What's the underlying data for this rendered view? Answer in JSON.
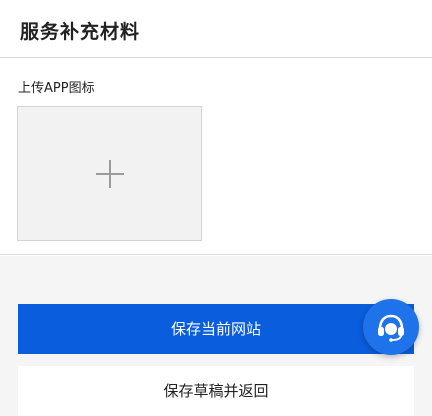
{
  "header": {
    "title": "服务补充材料"
  },
  "upload": {
    "label": "上传APP图标",
    "icon": "plus-icon"
  },
  "actions": {
    "save_label": "保存当前网站",
    "draft_label": "保存草稿并返回"
  },
  "support": {
    "icon": "customer-service-headset-icon"
  },
  "colors": {
    "primary": "#0a5ddc",
    "fab": "#1e73ea",
    "background_gray": "#f5f5f5",
    "upload_box": "#f2f2f2"
  }
}
